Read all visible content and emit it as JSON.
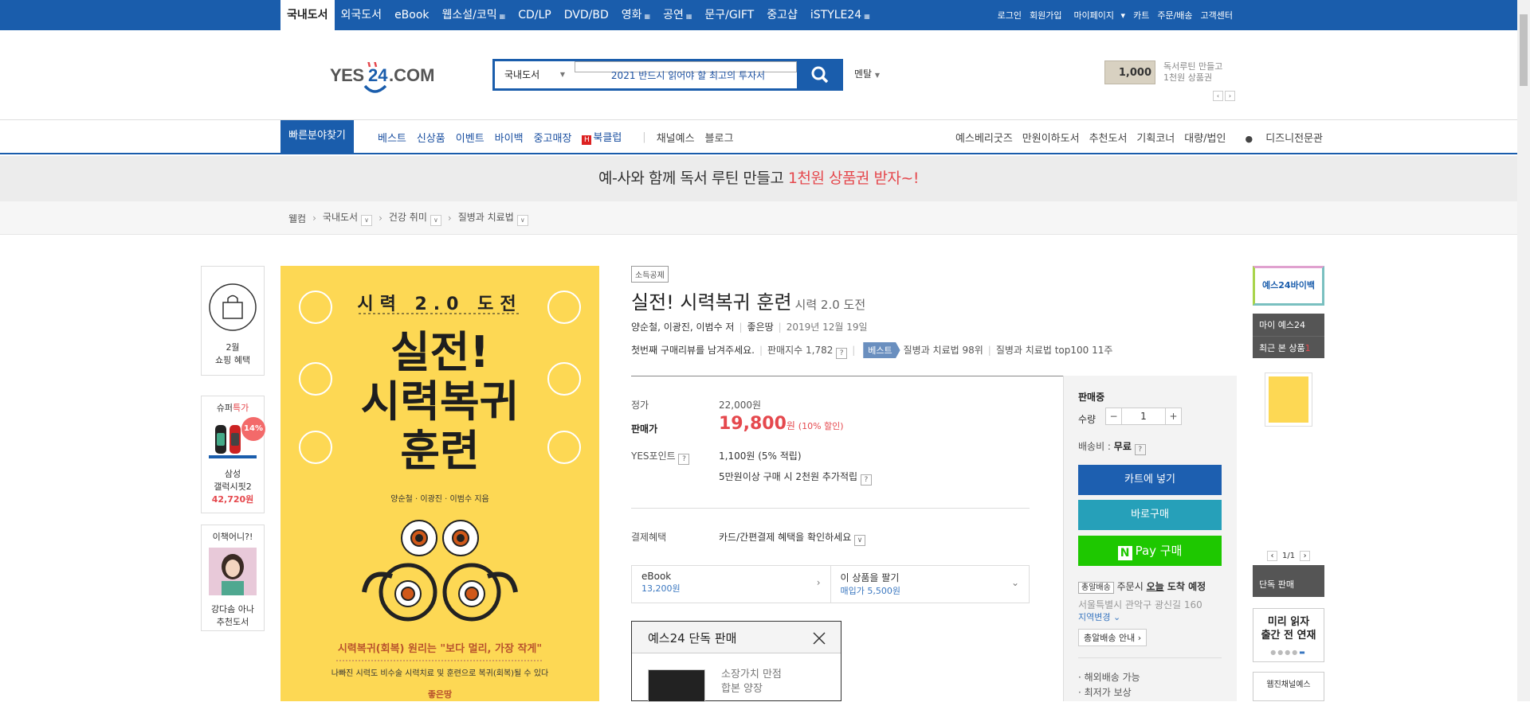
{
  "topbar": {
    "categories": [
      {
        "label": "국내도서",
        "active": true
      },
      {
        "label": "외국도서"
      },
      {
        "label": "eBook"
      },
      {
        "label": "웹소설/코믹"
      },
      {
        "label": "CD/LP"
      },
      {
        "label": "DVD/BD"
      },
      {
        "label": "영화"
      },
      {
        "label": "공연"
      },
      {
        "label": "문구/GIFT"
      },
      {
        "label": "중고샵"
      },
      {
        "label": "iSTYLE24"
      }
    ],
    "util": [
      "로그인",
      "회원가입",
      "마이페이지",
      "카트",
      "주문/배송",
      "고객센터"
    ]
  },
  "header": {
    "logo_text": "YES24.COM",
    "search_scope": "국내도서",
    "search_query": "2021 반드시 읽어야 할 최고의 투자서",
    "mental": "멘탈",
    "promo_amount": "1,000",
    "promo_line1": "독서루틴 만들고",
    "promo_line2": "1천원 상품권"
  },
  "nav": {
    "quick": "빠른분야찾기",
    "left": [
      "베스트",
      "신상품",
      "이벤트",
      "바이백",
      "중고매장",
      "북클럽",
      "채널예스",
      "블로그"
    ],
    "right": [
      "예스베리굿즈",
      "만원이하도서",
      "추천도서",
      "기획코너",
      "대량/법인",
      "디즈니전문관"
    ]
  },
  "banner": {
    "text": "예-사와 함께 독서 루틴 만들고 ",
    "highlight": "1천원 상품권 받자~!"
  },
  "breadcrumb": [
    "웰컴",
    "국내도서",
    "건강 취미",
    "질병과 치료법"
  ],
  "left_wing": {
    "shop_label1": "2월",
    "shop_label2": "쇼핑 혜택",
    "super_label": "슈퍼",
    "super_label_hl": "특가",
    "discount": "14%",
    "product_name1": "삼성",
    "product_name2": "갤럭시핏2",
    "product_price": "42,720원",
    "reco_title": "이책어니?!",
    "reco_name1": "강다솜 아나",
    "reco_name2": "추천도서"
  },
  "cover": {
    "challenge": "시력 2.0 도전",
    "title1": "실전!",
    "title2": "시력복귀",
    "title3": "훈련",
    "authors": "양순철 · 이광진 · 이범수",
    "authors_suffix": "지음",
    "tagline": "시력복귀(회복) 원리는 \"보다 멀리, 가장 작게\"",
    "tagline2": "나빠진 시력도 비수술 시력치료 및 훈련으로 복귀(회복)될 수 있다",
    "publisher_mark": "좋은땅"
  },
  "product": {
    "badge": "소득공제",
    "title": "실전! 시력복귀 훈련",
    "subtitle": "시력 2.0 도전",
    "authors": "양순철, 이광진, 이범수 저",
    "publisher": "좋은땅",
    "date": "2019년 12월 19일",
    "review_prompt": "첫번째 구매리뷰를 남겨주세요.",
    "sales_index_label": "판매지수 1,782",
    "best_badge": "베스트",
    "rank1": "질병과 치료법 98위",
    "rank2": "질병과 치료법 top100 11주",
    "list_price_label": "정가",
    "list_price": "22,000원",
    "sale_price_label": "판매가",
    "sale_price": "19,800",
    "sale_price_unit": "원",
    "discount": "(10% 할인)",
    "points_label": "YES포인트",
    "points": "1,100원 (5% 적립)",
    "points_extra": "5만원이상 구매 시 2천원 추가적립",
    "payment_label": "결제혜택",
    "payment_text": "카드/간편결제 혜택을 확인하세요",
    "ebook_label": "eBook",
    "ebook_price": "13,200원",
    "sell_label": "이 상품을 팔기",
    "sell_price": "매입가 5,500원",
    "exclusive_title": "예스24 단독 판매",
    "exclusive_line1": "소장가치 만점",
    "exclusive_line2": "합본 양장"
  },
  "buy": {
    "status": "판매중",
    "qty_label": "수량",
    "qty": "1",
    "ship_label": "배송비 : ",
    "ship_value": "무료",
    "cart": "카트에 넣기",
    "buy_now": "바로구매",
    "npay_suffix": "Pay 구매",
    "same_day": "총알배송",
    "same_day_text": "주문시 ",
    "same_day_today": "오늘",
    "same_day_text2": " 도착 예정",
    "address": "서울특별시 관악구 광신길 160",
    "region_change": "지역변경",
    "same_day_guide": "총알배송 안내",
    "overseas": "해외배송 가능",
    "min_ship": "최저가 보상"
  },
  "right_wing": {
    "buyback": "예스24바이백",
    "my": "마이 예스24",
    "recent_label": "최근 본 상품",
    "recent_count": "1",
    "pager": "1/1",
    "exclusive": "단독 판매",
    "preorder1": "미리 읽자",
    "preorder2": "출간 전 연재",
    "channel": "웹진채널예스"
  }
}
